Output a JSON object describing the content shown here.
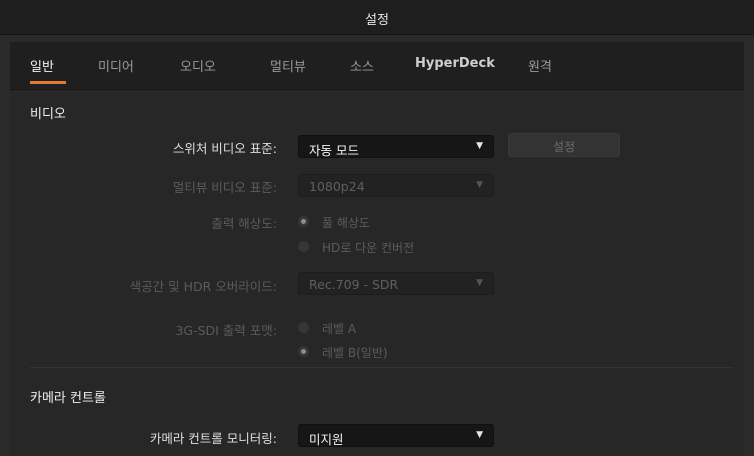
{
  "window": {
    "title": "설정"
  },
  "tabs": [
    {
      "label": "일반",
      "active": true
    },
    {
      "label": "미디어"
    },
    {
      "label": "오디오"
    },
    {
      "label": "멀티뷰"
    },
    {
      "label": "소스"
    },
    {
      "label": "HyperDeck"
    },
    {
      "label": "원격"
    }
  ],
  "video": {
    "section_title": "비디오",
    "switcher_standard": {
      "label": "스위처 비디오 표준:",
      "value": "자동 모드",
      "button": "설정"
    },
    "multiview_standard": {
      "label": "멀티뷰 비디오 표준:",
      "value": "1080p24"
    },
    "output_resolution": {
      "label": "출력 해상도:",
      "options": [
        "풀 해상도",
        "HD로 다운 컨버전"
      ],
      "selected": "풀 해상도"
    },
    "color_space": {
      "label": "색공간 및 HDR 오버라이드:",
      "value": "Rec.709 - SDR"
    },
    "sdi_format": {
      "label": "3G-SDI 출력 포맷:",
      "options": [
        "레벨 A",
        "레벨 B(일반)"
      ],
      "selected": "레벨 B(일반)"
    }
  },
  "camera": {
    "section_title": "카메라 컨트롤",
    "monitoring": {
      "label": "카메라 컨트롤 모니터링:",
      "value": "미지원"
    }
  },
  "colors": {
    "accent": "#e07a2d",
    "background": "#272727",
    "tabbar": "#1f1f1f"
  }
}
